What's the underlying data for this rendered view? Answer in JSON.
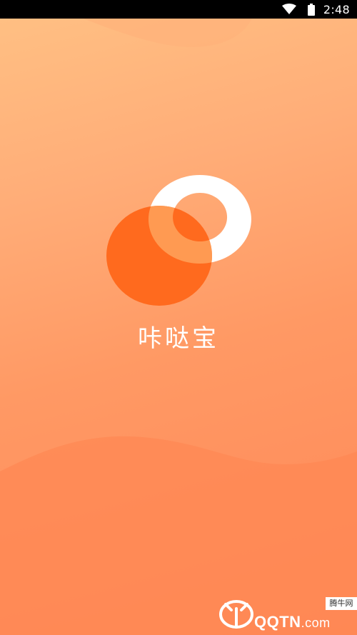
{
  "status_bar": {
    "time": "2:48",
    "icons": [
      "wifi-icon",
      "battery-icon"
    ]
  },
  "app": {
    "name": "咔哒宝"
  },
  "watermark": {
    "text": "QQTN",
    "suffix": ".com",
    "site_label": "腾牛网"
  },
  "colors": {
    "gradient_top": "#ffc184",
    "gradient_bottom": "#ff8856",
    "logo_orange": "#ff6a1e",
    "logo_white": "#ffffff"
  }
}
